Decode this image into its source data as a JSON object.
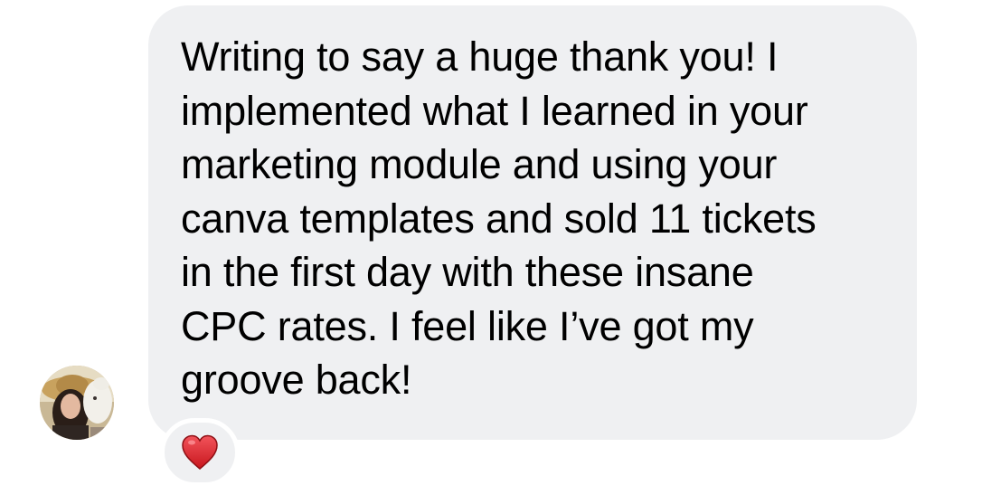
{
  "message": {
    "lines": [
      "Writing to say a huge thank you! I",
      "implemented what I learned in your",
      "marketing module and using your",
      "canva templates and sold 11 tickets",
      "in the first day with these insane",
      "CPC rates. I feel like I’ve got my",
      "groove back!"
    ]
  },
  "sender": {
    "avatar_icon": "profile-photo"
  },
  "reaction": {
    "icon": "red-heart-icon",
    "color": "#e02a2a"
  },
  "colors": {
    "bubble": "#eff0f2",
    "text": "#000000",
    "background": "#ffffff"
  }
}
